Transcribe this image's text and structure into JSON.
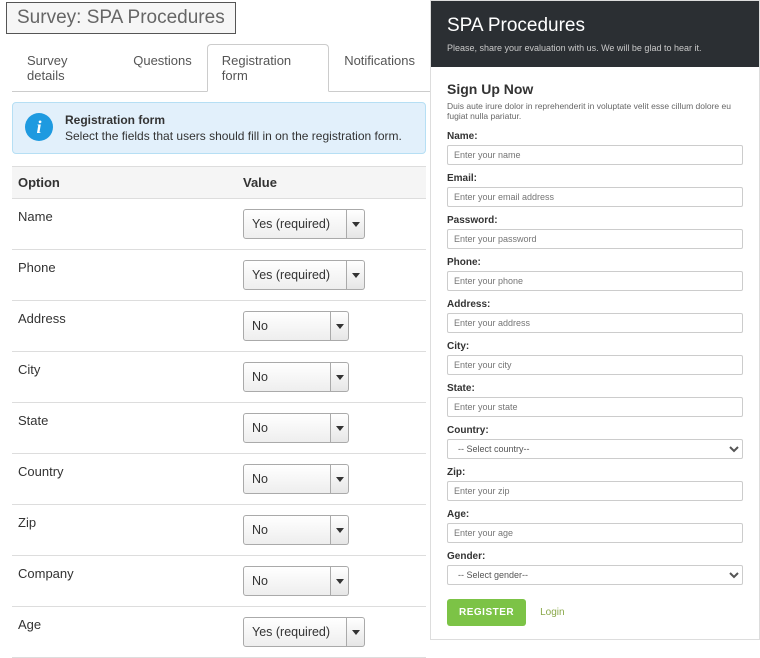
{
  "title": "Survey: SPA Procedures",
  "tabs": [
    {
      "label": "Survey details",
      "active": false
    },
    {
      "label": "Questions",
      "active": false
    },
    {
      "label": "Registration form",
      "active": true
    },
    {
      "label": "Notifications",
      "active": false
    }
  ],
  "info": {
    "icon": "i",
    "title": "Registration form",
    "text": "Select the fields that users should fill in on the registration form."
  },
  "grid": {
    "headers": {
      "option": "Option",
      "value": "Value"
    },
    "rows": [
      {
        "option": "Name",
        "value": "Yes (required)"
      },
      {
        "option": "Phone",
        "value": "Yes (required)"
      },
      {
        "option": "Address",
        "value": "No"
      },
      {
        "option": "City",
        "value": "No"
      },
      {
        "option": "State",
        "value": "No"
      },
      {
        "option": "Country",
        "value": "No"
      },
      {
        "option": "Zip",
        "value": "No"
      },
      {
        "option": "Company",
        "value": "No"
      },
      {
        "option": "Age",
        "value": "Yes (required)"
      }
    ]
  },
  "preview": {
    "header_title": "SPA Procedures",
    "header_sub": "Please, share your evaluation with us. We will be glad to hear it.",
    "signup_title": "Sign Up Now",
    "signup_desc": "Duis aute irure dolor in reprehenderit in voluptate velit esse cillum dolore eu fugiat nulla pariatur.",
    "fields": [
      {
        "label": "Name:",
        "placeholder": "Enter your name",
        "type": "text"
      },
      {
        "label": "Email:",
        "placeholder": "Enter your email address",
        "type": "text"
      },
      {
        "label": "Password:",
        "placeholder": "Enter your password",
        "type": "text"
      },
      {
        "label": "Phone:",
        "placeholder": "Enter your phone",
        "type": "text"
      },
      {
        "label": "Address:",
        "placeholder": "Enter your address",
        "type": "text"
      },
      {
        "label": "City:",
        "placeholder": "Enter your city",
        "type": "text"
      },
      {
        "label": "State:",
        "placeholder": "Enter your state",
        "type": "text"
      },
      {
        "label": "Country:",
        "placeholder": "-- Select country--",
        "type": "select"
      },
      {
        "label": "Zip:",
        "placeholder": "Enter your zip",
        "type": "text"
      },
      {
        "label": "Age:",
        "placeholder": "Enter your age",
        "type": "text"
      },
      {
        "label": "Gender:",
        "placeholder": "-- Select gender--",
        "type": "select"
      }
    ],
    "register_label": "REGISTER",
    "login_label": "Login"
  }
}
